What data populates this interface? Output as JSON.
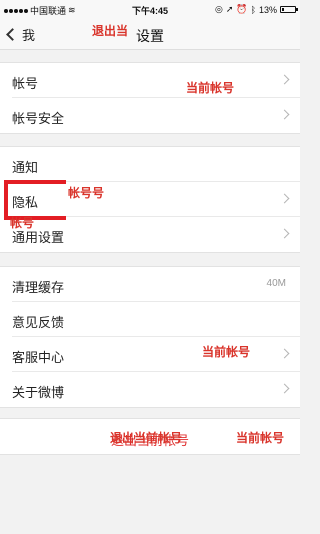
{
  "status_bar": {
    "carrier": "中国联通",
    "time": "下午4:45",
    "battery": "13%"
  },
  "nav": {
    "back_label": "我",
    "title": "设置"
  },
  "groups": [
    {
      "rows": [
        {
          "label": "帐号",
          "chevron": true
        },
        {
          "label": "帐号安全",
          "chevron": true
        }
      ]
    },
    {
      "rows": [
        {
          "label": "通知",
          "chevron": false
        },
        {
          "label": "隐私",
          "chevron": true
        },
        {
          "label": "通用设置",
          "chevron": true
        }
      ]
    },
    {
      "rows": [
        {
          "label": "清理缓存",
          "value": "40M",
          "chevron": false
        },
        {
          "label": "意见反馈",
          "chevron": false
        },
        {
          "label": "客服中心",
          "chevron": true
        },
        {
          "label": "关于微博",
          "chevron": true
        }
      ]
    }
  ],
  "logout": {
    "label": "退出当前帐号"
  },
  "annotations": {
    "overlay_1": "退出当",
    "overlay_2": "当前帐号",
    "overlay_3": "帐号号",
    "overlay_4": "帐号",
    "overlay_5": "当前帐号",
    "overlay_6": "退出当前帐号",
    "overlay_7": "当前帐号",
    "accent_color": "#d9342b"
  }
}
